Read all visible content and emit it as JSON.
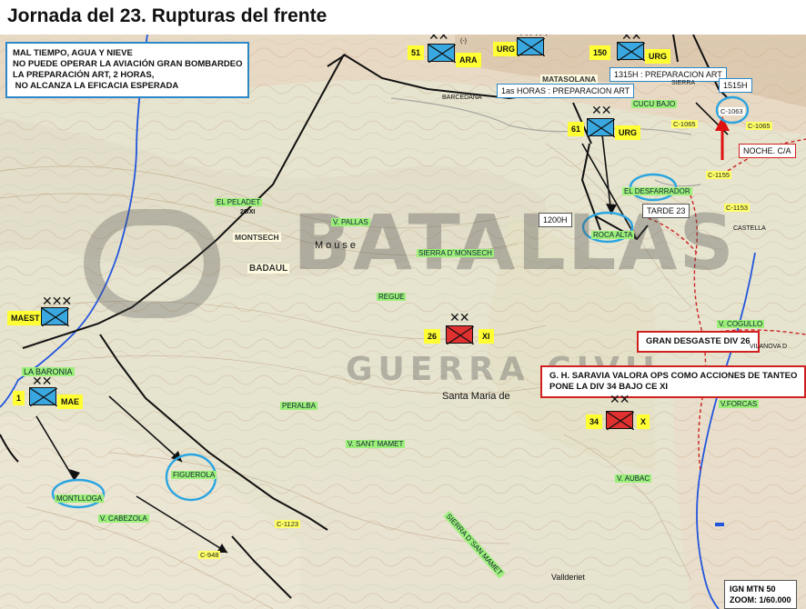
{
  "title": "Jornada del 23. Rupturas del frente",
  "notes": {
    "weather": "MAL TIEMPO, AGUA Y NIEVE\nNO PUEDE OPERAR LA AVIACIÓN GRAN BOMBARDEO\nLA PREPARACIÓN ART, 2 HORAS,\n NO ALCANZA LA EFICACIA ESPERADA",
    "desgaste": "GRAN DESGASTE DIV 26",
    "saravia": "G. H. SARAVIA VALORA OPS COMO ACCIONES DE TANTEO\nPONE LA DIV 34 BAJO CE XI",
    "prep1": "1as HORAS : PREPARACION ART",
    "prep2": "1315H : PREPARACION ART",
    "t1515": "1515H",
    "noche": "NOCHE. C/A",
    "tarde": "TARDE 23",
    "t1200": "1200H",
    "ign": "IGN MTN 50\nZOOM: 1/60.000"
  },
  "units": {
    "u51": {
      "label": "51",
      "tag": "ARA",
      "extra": "(-)",
      "echelon": "✕✕",
      "color": "#3aa8e0"
    },
    "urg1": {
      "label": "URG",
      "echelon": "✕✕✕",
      "color": "#3aa8e0"
    },
    "u150": {
      "label": "150",
      "tag": "URG",
      "echelon": "✕✕",
      "color": "#3aa8e0"
    },
    "u61": {
      "label": "61",
      "tag": "URG",
      "echelon": "✕✕",
      "color": "#3aa8e0"
    },
    "maest": {
      "label": "MAEST",
      "echelon": "✕✕✕",
      "color": "#3aa8e0"
    },
    "u1": {
      "label": "1",
      "tag": "MAE",
      "echelon": "✕✕",
      "color": "#3aa8e0"
    },
    "u26": {
      "label": "26",
      "tag": "XI",
      "echelon": "✕✕",
      "color": "#e03030"
    },
    "u34": {
      "label": "34",
      "tag": "X",
      "echelon": "✕✕",
      "color": "#e03030"
    }
  },
  "places": {
    "matasolana": "MATASOLANA",
    "cucu": "CUCU BAJO",
    "sierra": "SIERRA",
    "barcedana": "BARCEDANA",
    "desfarrador": "EL DESFARRADOR",
    "roca": "ROCA ALTA",
    "peladet": "EL PELADET",
    "xi26": "26/XI",
    "pallas": "V. PALLAS",
    "montsech": "MONTSECH",
    "badaul": "BADAUL",
    "sierra_m": "SIERRA D´MONSECH",
    "regue": "REGUE",
    "baronia": "LA BARONIA",
    "peralba": "PERALBA",
    "sant_mamet": "V. SANT MAMET",
    "figuerola": "FIGUEROLA",
    "montlloga": "MONTLLOGA",
    "cabezola": "V. CABEZOLA",
    "aubac": "V. AUBAC",
    "forcas": "V.FORCAS",
    "cogullo": "V. COGULLO",
    "vilanova": "VILANOVA D",
    "castella": "CASTELLA",
    "sierra_s": "SIERRA D´SAN MAMET",
    "santa_maria": "Santa Maria de",
    "vallderiet": "Vallderiet",
    "mouse": "Mouse"
  },
  "roads": {
    "c1063": "C-1063",
    "c1065": "C-1065",
    "c1065b": "C-1065",
    "c1155": "C-1155",
    "c1153": "C-1153",
    "c1123": "C-1123",
    "c948": "C-948"
  },
  "watermark": {
    "big": "BATALLAS",
    "small": "GUERRA CIVIL"
  },
  "colors": {
    "unit_blue": "#3aa8e0",
    "unit_red": "#e03030",
    "front": "#111111",
    "highlight": "#2aa5e0",
    "river": "#2255dd",
    "road_red": "#cc2222"
  }
}
